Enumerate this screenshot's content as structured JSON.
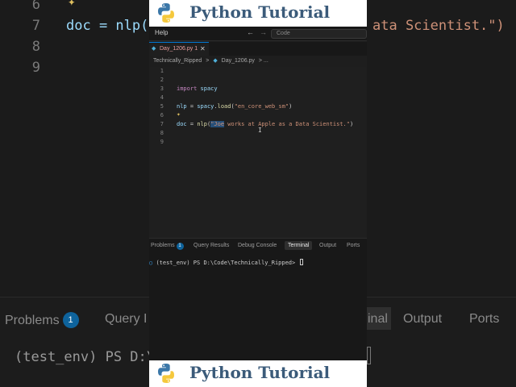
{
  "banner": {
    "title": "Python Tutorial"
  },
  "background": {
    "lines": [
      {
        "num": "6",
        "text": ""
      },
      {
        "num": "7",
        "text": "doc = nlp(",
        "right": "ata Scientist.\")"
      },
      {
        "num": "8",
        "text": ""
      },
      {
        "num": "9",
        "text": ""
      }
    ],
    "tabs": {
      "problems": "Problems",
      "problems_count": "1",
      "query": "Query I",
      "terminal": "inal",
      "output": "Output",
      "ports": "Ports"
    },
    "terminal": "(test_env) PS D:\\"
  },
  "titlebar": {
    "menu": "Help",
    "back": "←",
    "forward": "→",
    "search_placeholder": "Code"
  },
  "tab": {
    "icon": "python-file-icon",
    "label": "Day_1206.py 1",
    "close": "✕"
  },
  "breadcrumb": {
    "folder": "Technically_Ripped",
    "sep": ">",
    "file": "Day_1206.py",
    "more": "> ..."
  },
  "editor": {
    "line_numbers": [
      "1",
      "2",
      "3",
      "4",
      "5",
      "6",
      "7",
      "8",
      "9"
    ],
    "line3": {
      "kw": "import",
      "mod": "spacy"
    },
    "line5": {
      "var": "nlp",
      "eq": " = ",
      "obj": "spacy",
      "dot": ".",
      "fn": "load",
      "open": "(",
      "arg": "\"en_core_web_sm\"",
      "close": ")"
    },
    "line7": {
      "var": "doc",
      "eq": " = ",
      "fn": "nlp",
      "open": "(",
      "sel": "\"Joe",
      "rest": " works at Apple as a Data Scientist.\"",
      "close": ")"
    }
  },
  "panel": {
    "tabs": [
      "Problems",
      "Query Results",
      "Debug Console",
      "Terminal",
      "Output",
      "Ports"
    ],
    "problems_count": "1",
    "terminal_prompt": "(test_env) PS D:\\Code\\Technically_Ripped> ",
    "terminal_marker": "○"
  },
  "colors": {
    "accent": "#0078d4",
    "banner_text": "#3b5b7a",
    "string": "#ce9178",
    "keyword": "#c586c0"
  }
}
